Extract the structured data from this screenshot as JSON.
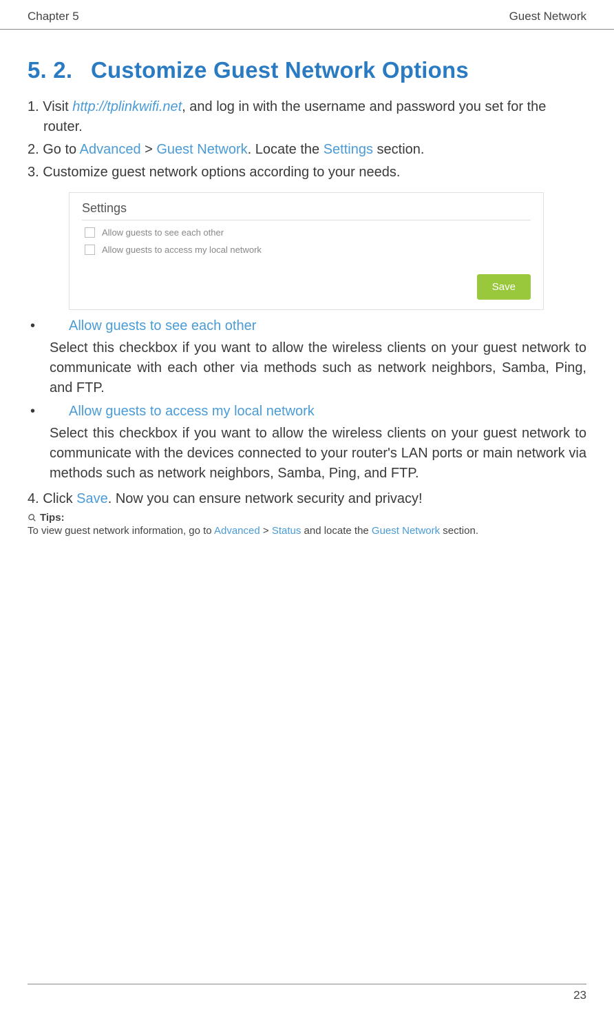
{
  "header": {
    "chapter": "Chapter 5",
    "section_title": "Guest Network"
  },
  "heading": {
    "number": "5. 2.",
    "title": "Customize Guest Network Options"
  },
  "steps": {
    "step1_prefix": "1. Visit ",
    "step1_link": "http://tplinkwifi.net",
    "step1_suffix": ", and log in with the username and password you set for the router.",
    "step2_prefix": "2. Go to ",
    "step2_adv": "Advanced",
    "step2_gt": " > ",
    "step2_gn": "Guest Network",
    "step2_mid": ". Locate the ",
    "step2_settings": "Settings",
    "step2_suffix": " section.",
    "step3": "3. Customize guest network options according to your needs.",
    "step4_prefix": "4. Click ",
    "step4_save": "Save",
    "step4_suffix": ". Now you can ensure network security and privacy!"
  },
  "panel": {
    "title": "Settings",
    "option1": "Allow guests to see each other",
    "option2": "Allow guests to access my local network",
    "save_button": "Save"
  },
  "options": {
    "opt1_title": "Allow guests to see each other",
    "opt1_desc": "Select this checkbox if you want to allow the wireless clients on your guest network to communicate with each other via methods such as network neighbors, Samba, Ping, and FTP.",
    "opt2_title": "Allow guests to access my local network",
    "opt2_desc": "Select this checkbox if you want to allow the wireless clients on your guest network to communicate with the devices connected to your router's LAN ports or main network via methods such as network neighbors, Samba, Ping, and FTP."
  },
  "tips": {
    "label": "Tips:",
    "text_prefix": "To view guest network information, go to ",
    "adv": "Advanced",
    "gt": " > ",
    "status": "Status",
    "mid": " and locate the ",
    "gn": "Guest Network",
    "suffix": " section."
  },
  "page_number": "23"
}
